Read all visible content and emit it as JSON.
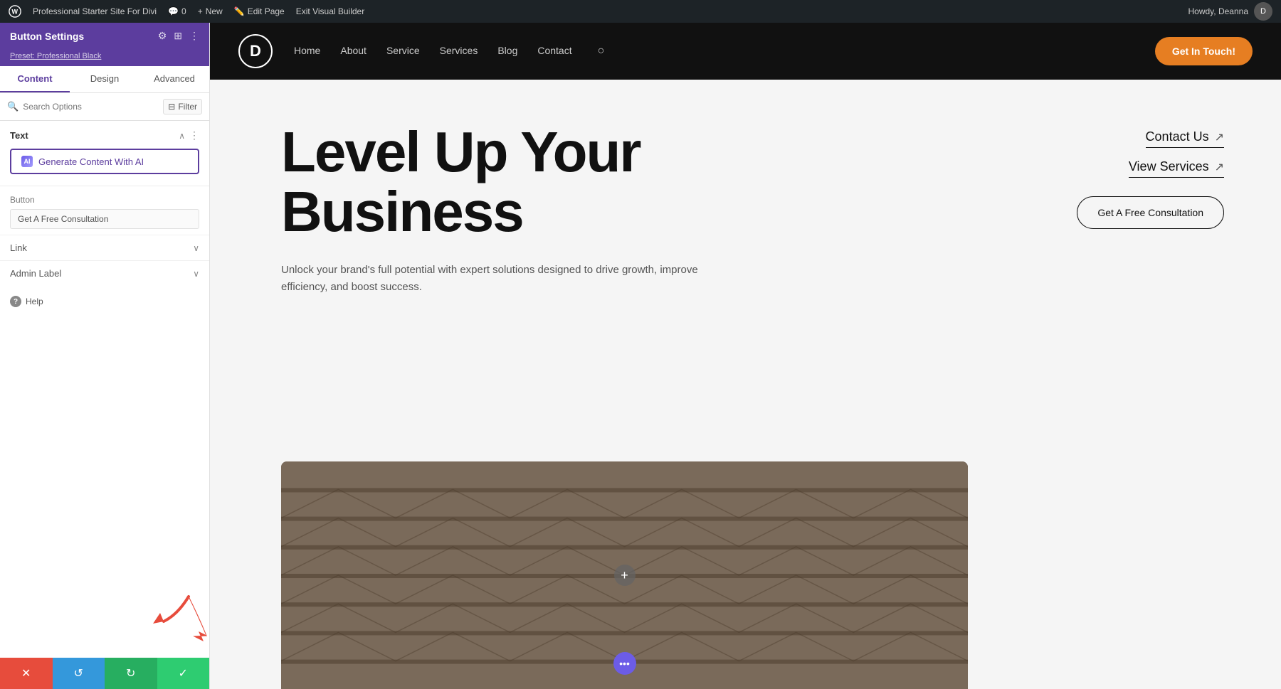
{
  "admin_bar": {
    "wp_label": "WordPress",
    "site_label": "Professional Starter Site For Divi",
    "comments_label": "0",
    "new_label": "New",
    "new_badge": "New",
    "edit_page_label": "Edit Page",
    "exit_builder_label": "Exit Visual Builder",
    "howdy_label": "Howdy, Deanna"
  },
  "panel": {
    "title": "Button Settings",
    "preset": "Preset: Professional Black",
    "tabs": {
      "content": "Content",
      "design": "Design",
      "advanced": "Advanced"
    },
    "search_placeholder": "Search Options",
    "filter_label": "Filter",
    "sections": {
      "text": {
        "label": "Text",
        "ai_button": "Generate Content With AI"
      },
      "button": {
        "label": "Button",
        "value": "Get A Free Consultation"
      },
      "link": {
        "label": "Link"
      },
      "admin_label": {
        "label": "Admin Label"
      }
    },
    "help_label": "Help"
  },
  "bottom_bar": {
    "cancel_icon": "✕",
    "undo_icon": "↺",
    "redo_icon": "↻",
    "save_icon": "✓"
  },
  "site": {
    "logo_letter": "D",
    "nav": {
      "home": "Home",
      "about": "About",
      "service": "Service",
      "services": "Services",
      "blog": "Blog",
      "contact": "Contact"
    },
    "cta_button": "Get In Touch!"
  },
  "hero": {
    "title_line1": "Level Up Your",
    "title_line2": "Business",
    "subtitle": "Unlock your brand's full potential with expert solutions designed to drive growth, improve efficiency, and boost success.",
    "contact_link": "Contact Us",
    "view_services_link": "View Services",
    "consultation_btn": "Get A Free Consultation",
    "link_arrow": "↗"
  }
}
